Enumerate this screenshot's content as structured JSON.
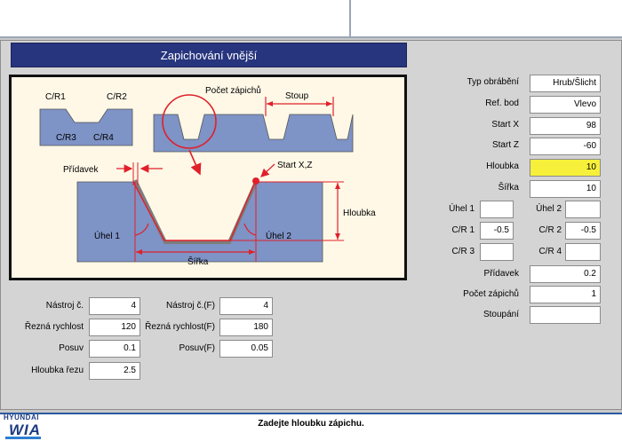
{
  "screen_title": "Zapichování vnější",
  "diagram": {
    "labels": {
      "cr1": "C/R1",
      "cr2": "C/R2",
      "cr3": "C/R3",
      "cr4": "C/R4",
      "pocet_zapichu": "Počet zápichů",
      "stoup": "Stoup",
      "pridavek": "Přídavek",
      "start_xz": "Start X,Z",
      "uhel1": "Úhel 1",
      "uhel2": "Úhel 2",
      "hloubka": "Hloubka",
      "sirka": "Šířka"
    },
    "colors": {
      "part": "#7e93c6",
      "red": "#e0202a",
      "tool": "#7d7d7d",
      "background": "#fff8e7"
    }
  },
  "right_params": [
    {
      "label": "Typ obrábění",
      "value": "Hrub/Šlicht"
    },
    {
      "label": "Ref. bod",
      "value": "Vlevo"
    },
    {
      "label": "Start X",
      "value": "98"
    },
    {
      "label": "Start Z",
      "value": "-60"
    },
    {
      "label": "Hloubka",
      "value": "10",
      "highlighted": true
    },
    {
      "label": "Šířka",
      "value": "10"
    }
  ],
  "angles": {
    "uhel1_label": "Úhel 1",
    "uhel1_value": "",
    "uhel2_label": "Úhel 2",
    "uhel2_value": "",
    "cr1_label": "C/R 1",
    "cr1_value": "-0.5",
    "cr2_label": "C/R 2",
    "cr2_value": "-0.5",
    "cr3_label": "C/R 3",
    "cr3_value": "",
    "cr4_label": "C/R 4",
    "cr4_value": ""
  },
  "right_bottom": [
    {
      "label": "Přídavek",
      "value": "0.2"
    },
    {
      "label": "Počet zápichů",
      "value": "1"
    },
    {
      "label": "Stoupání",
      "value": ""
    }
  ],
  "tool_params_left": [
    {
      "label": "Nástroj č.",
      "value": "4"
    },
    {
      "label": "Řezná rychlost",
      "value": "120"
    },
    {
      "label": "Posuv",
      "value": "0.1"
    },
    {
      "label": "Hloubka řezu",
      "value": "2.5"
    }
  ],
  "tool_params_right": [
    {
      "label": "Nástroj č.(F)",
      "value": "4"
    },
    {
      "label": "Řezná rychlost(F)",
      "value": "180"
    },
    {
      "label": "Posuv(F)",
      "value": "0.05"
    }
  ],
  "status_message": "Zadejte hloubku zápichu.",
  "logo": {
    "top": "HYUNDAI",
    "main": "WIA"
  },
  "colors": {
    "title_bar": "#27357e",
    "highlight": "#f7f03a"
  }
}
